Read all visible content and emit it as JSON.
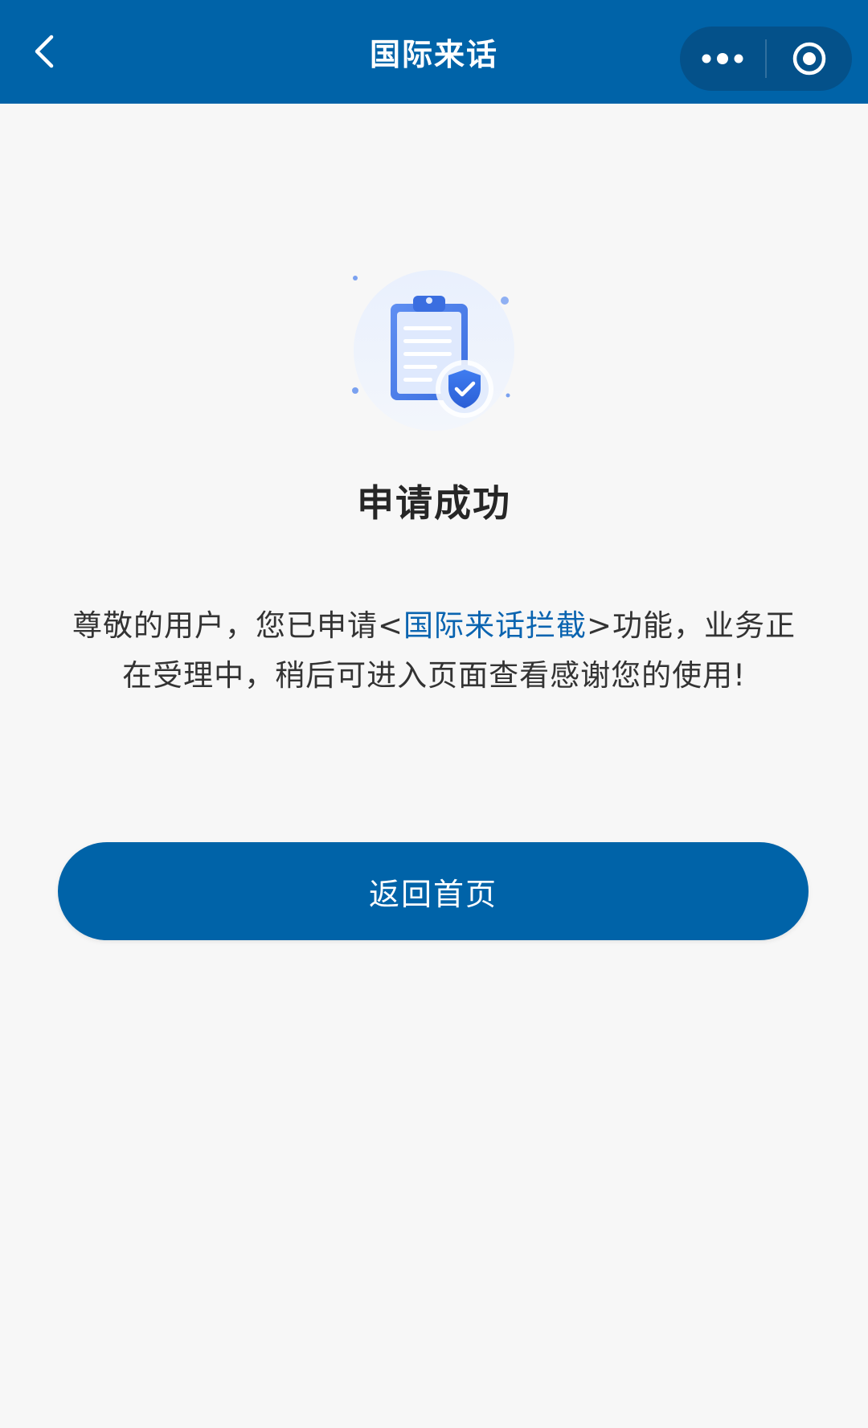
{
  "header": {
    "title": "国际来话",
    "back_icon": "chevron-left-icon",
    "more_icon": "ellipsis-icon",
    "close_icon": "target-circle-icon"
  },
  "result": {
    "icon": "clipboard-shield-check-icon",
    "title": "申请成功",
    "desc_prefix": "尊敬的用户，您已申请<",
    "desc_link": "国际来话拦截",
    "desc_suffix": ">功能，业务正在受理中，稍后可进入页面查看感谢您的使用!"
  },
  "actions": {
    "home_label": "返回首页"
  },
  "colors": {
    "primary": "#0063a8",
    "link": "#0a64b0",
    "background": "#f7f7f7",
    "title_text": "#262626",
    "body_text": "#333333"
  }
}
